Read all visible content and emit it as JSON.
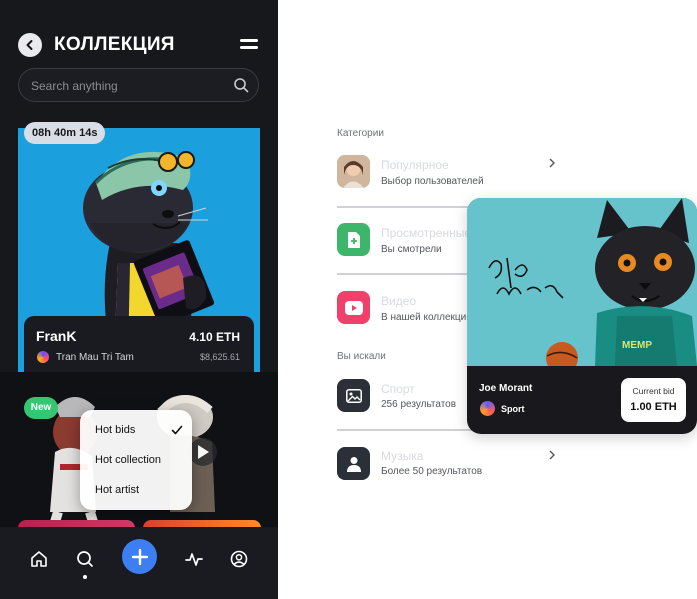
{
  "header": {
    "title": "КОЛЛЕКЦИЯ"
  },
  "search": {
    "placeholder": "Search anything"
  },
  "featured": {
    "timer": "08h 40m 14s",
    "name": "FranK",
    "price": "4.10 ETH",
    "creator": "Tran Mau Tri Tam",
    "price_usd": "$8,625.61"
  },
  "second": {
    "badge": "New"
  },
  "sort_menu": {
    "options": [
      "Hot bids",
      "Hot collection",
      "Hot artist"
    ],
    "selected": "Hot bids"
  },
  "bottom_nav": {
    "items": [
      "home-icon",
      "search-icon",
      "plus-icon",
      "activity-icon",
      "profile-icon"
    ],
    "active": "search-icon"
  },
  "categories_panel": {
    "categories_label": "Категории",
    "categories": [
      {
        "title": "Популярное",
        "subtitle": "Выбор пользователей",
        "icon": "avatar"
      },
      {
        "title": "Просмотренные",
        "subtitle": "Вы смотрели",
        "icon": "document-plus-icon"
      },
      {
        "title": "Видео",
        "subtitle": "В нашей коллекции",
        "icon": "play-icon"
      }
    ],
    "history_label": "Вы искали",
    "history": [
      {
        "title": "Спорт",
        "subtitle": "256 результатов",
        "icon": "image-icon"
      },
      {
        "title": "Музыка",
        "subtitle": "Более 50 результатов",
        "icon": "user-icon"
      }
    ]
  },
  "art_card": {
    "name": "Joe Morant",
    "category": "Sport",
    "bid_label": "Current bid",
    "bid_value": "1.00 ETH",
    "signature": "Джо Морант"
  },
  "colors": {
    "accent": "#3d7ff2",
    "new_badge": "#34c771",
    "hero_bg": "#1ba0dd",
    "art_bg": "#66c3cc"
  }
}
